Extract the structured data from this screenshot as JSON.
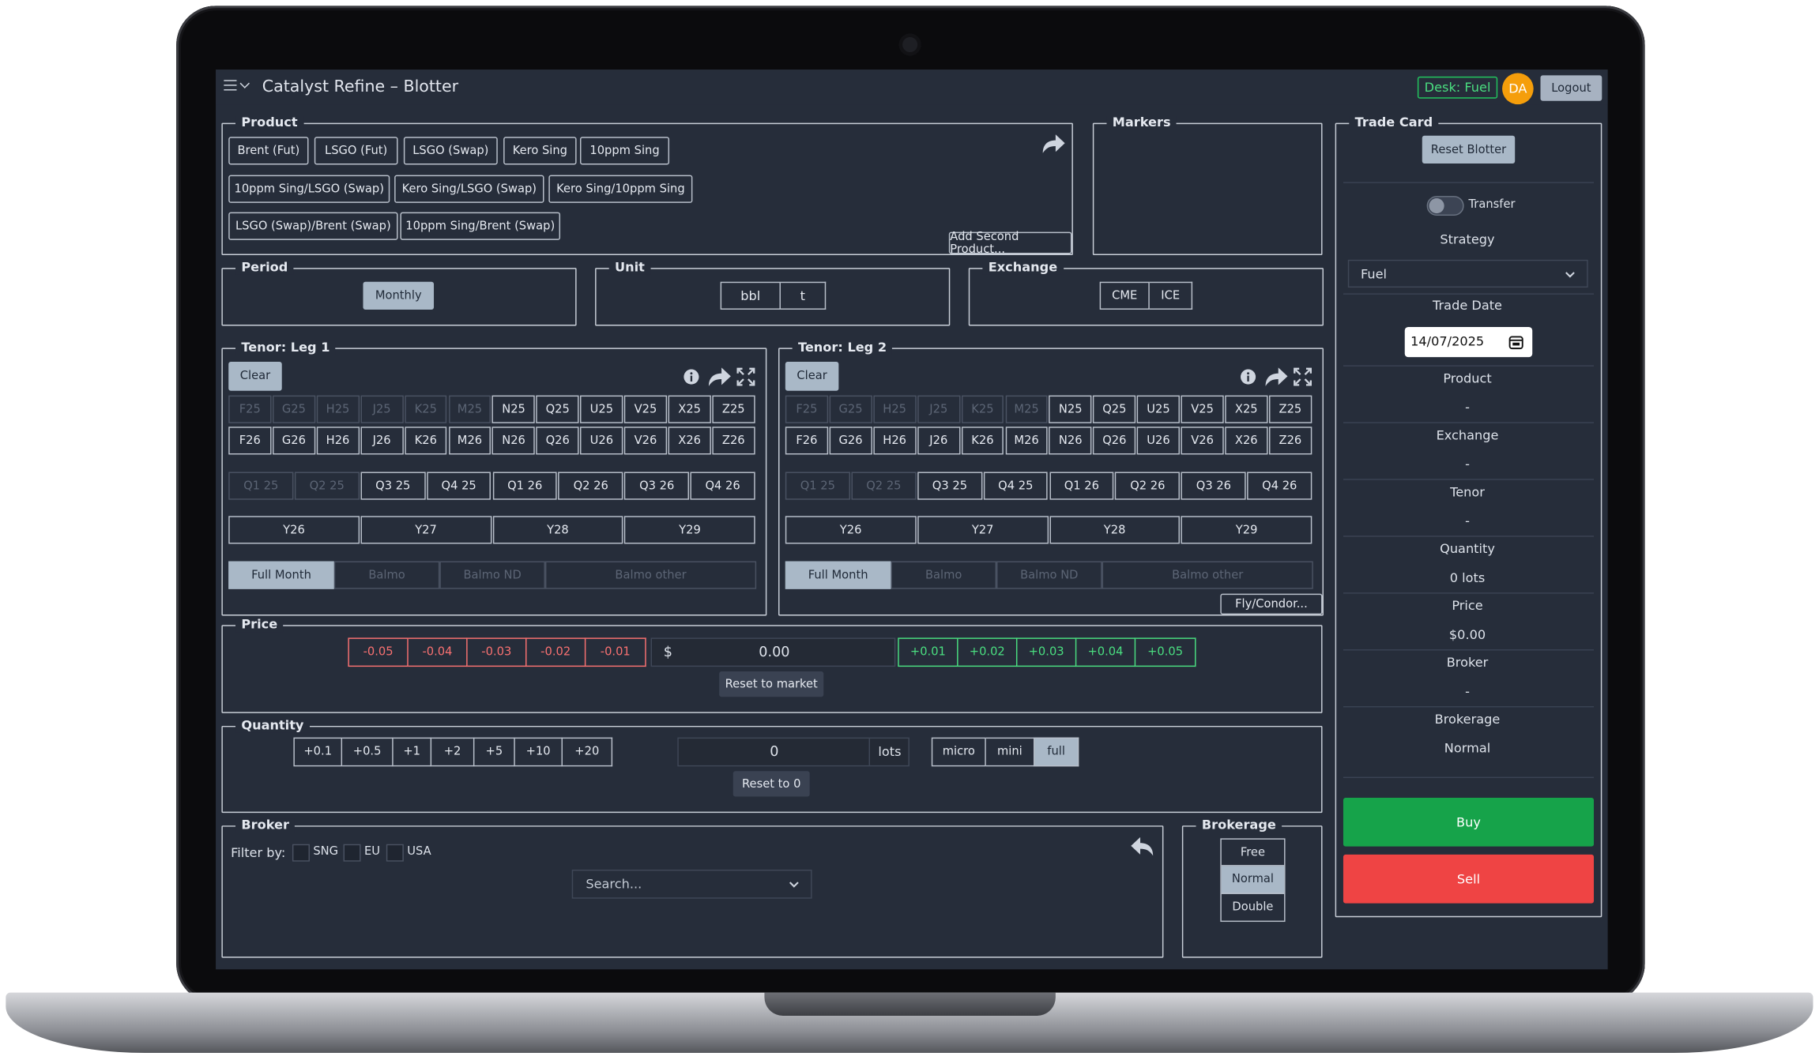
{
  "app": {
    "title": "Catalyst Refine – Blotter",
    "desk": "Desk: Fuel",
    "avatar": "DA",
    "logout": "Logout"
  },
  "product": {
    "legend": "Product",
    "row1": [
      "Brent (Fut)",
      "LSGO (Fut)",
      "LSGO (Swap)",
      "Kero Sing",
      "10ppm Sing"
    ],
    "row2": [
      "10ppm Sing/LSGO (Swap)",
      "Kero Sing/LSGO (Swap)",
      "Kero Sing/10ppm Sing"
    ],
    "row3": [
      "LSGO (Swap)/Brent (Swap)",
      "10ppm Sing/Brent (Swap)"
    ],
    "add_second": "Add Second Product..."
  },
  "markers": {
    "legend": "Markers"
  },
  "period": {
    "legend": "Period",
    "value": "Monthly"
  },
  "unit": {
    "legend": "Unit",
    "options": [
      "bbl",
      "t"
    ]
  },
  "exchange": {
    "legend": "Exchange",
    "options": [
      "CME",
      "ICE"
    ]
  },
  "tenor1": {
    "legend": "Tenor: Leg 1"
  },
  "tenor2": {
    "legend": "Tenor: Leg 2"
  },
  "tenor": {
    "clear": "Clear",
    "months25": [
      "F25",
      "G25",
      "H25",
      "J25",
      "K25",
      "M25",
      "N25",
      "Q25",
      "U25",
      "V25",
      "X25",
      "Z25"
    ],
    "months26": [
      "F26",
      "G26",
      "H26",
      "J26",
      "K26",
      "M26",
      "N26",
      "Q26",
      "U26",
      "V26",
      "X26",
      "Z26"
    ],
    "quarters": [
      "Q1 25",
      "Q2 25",
      "Q3 25",
      "Q4 25",
      "Q1 26",
      "Q2 26",
      "Q3 26",
      "Q4 26"
    ],
    "years": [
      "Y26",
      "Y27",
      "Y28",
      "Y29"
    ],
    "modes": [
      "Full Month",
      "Balmo",
      "Balmo ND",
      "Balmo other"
    ],
    "fly": "Fly/Condor..."
  },
  "price": {
    "legend": "Price",
    "decrements": [
      "-0.05",
      "-0.04",
      "-0.03",
      "-0.02",
      "-0.01"
    ],
    "currency": "$",
    "value": "0.00",
    "increments": [
      "+0.01",
      "+0.02",
      "+0.03",
      "+0.04",
      "+0.05"
    ],
    "reset": "Reset to market"
  },
  "quantity": {
    "legend": "Quantity",
    "increments": [
      "+0.1",
      "+0.5",
      "+1",
      "+2",
      "+5",
      "+10",
      "+20"
    ],
    "value": "0",
    "unit": "lots",
    "sizes": [
      "micro",
      "mini",
      "full"
    ],
    "reset": "Reset to 0"
  },
  "broker": {
    "legend": "Broker",
    "filter_label": "Filter by:",
    "filters": [
      "SNG",
      "EU",
      "USA"
    ],
    "search_placeholder": "Search..."
  },
  "brokerage": {
    "legend": "Brokerage",
    "options": [
      "Free",
      "Normal",
      "Double"
    ]
  },
  "trade_card": {
    "legend": "Trade Card",
    "reset": "Reset Blotter",
    "transfer": "Transfer",
    "strategy_label": "Strategy",
    "strategy_value": "Fuel",
    "trade_date_label": "Trade Date",
    "trade_date": "14/07/2025",
    "product_label": "Product",
    "product_value": "-",
    "exchange_label": "Exchange",
    "exchange_value": "-",
    "tenor_label": "Tenor",
    "tenor_value": "-",
    "quantity_label": "Quantity",
    "quantity_value": "0 lots",
    "price_label": "Price",
    "price_value": "$0.00",
    "broker_label": "Broker",
    "broker_value": "-",
    "brokerage_label": "Brokerage",
    "brokerage_value": "Normal",
    "buy": "Buy",
    "sell": "Sell"
  },
  "colors": {
    "background": "#262d3a",
    "buy": "#16a34a",
    "sell": "#ef4444",
    "accent": "#a9b8c7",
    "desk": "#22c55e",
    "avatar": "#f59e0b"
  }
}
